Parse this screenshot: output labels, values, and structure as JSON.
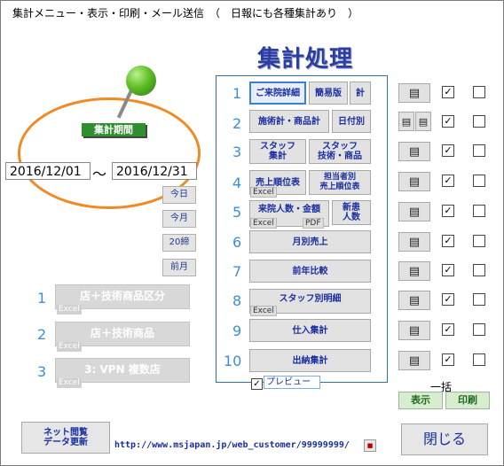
{
  "window": {
    "title": "集計メニュー・表示・印刷・メール送信　（　日報にも各種集計あり　）"
  },
  "heading": "集計処理",
  "period": {
    "label": "集計期間",
    "start": "2016/12/01",
    "separator": "～",
    "end": "2016/12/31",
    "quick": [
      "今日",
      "今月",
      "20締",
      "前月"
    ]
  },
  "categories": [
    {
      "num": "1",
      "label": "店＋技術商品区分",
      "tag": "Excel"
    },
    {
      "num": "2",
      "label": "店＋技術商品",
      "tag": "Excel"
    },
    {
      "num": "3",
      "label": "3: VPN 複数店",
      "tag": "Excel"
    }
  ],
  "rows": {
    "nums": [
      "1",
      "2",
      "3",
      "4",
      "5",
      "6",
      "7",
      "8",
      "9",
      "10"
    ],
    "r1": {
      "a": "ご来院詳細",
      "b": "簡易版",
      "c": "計"
    },
    "r2": {
      "a": "施術計・商品計",
      "b": "日付別"
    },
    "r3": {
      "a": "スタッフ\n集計",
      "b": "スタッフ\n技術・商品"
    },
    "r4": {
      "a": "売上順位表",
      "a_tag": "Excel",
      "b": "担当者別\n売上順位表"
    },
    "r5": {
      "a": "来院人数・金額",
      "a_tag": "Excel",
      "a_tag2": "PDF",
      "b": "新患\n人数"
    },
    "r6": {
      "a": "月別売上"
    },
    "r7": {
      "a": "前年比較"
    },
    "r8": {
      "a": "スタッフ別明細",
      "a_tag": "Excel"
    },
    "r9": {
      "a": "仕入集計"
    },
    "r10": {
      "a": "出納集計"
    }
  },
  "print_icon": "printer-icon",
  "check_mark": "✓",
  "preview": {
    "label": "プレビュー",
    "checked": true
  },
  "bulk": {
    "label": "一括",
    "show": "表示",
    "print": "印刷"
  },
  "net": {
    "label": "ネット閲覧\nデータ更新"
  },
  "url": "http://www.msjapan.jp/web_customer/99999999/",
  "close": "閉じる"
}
